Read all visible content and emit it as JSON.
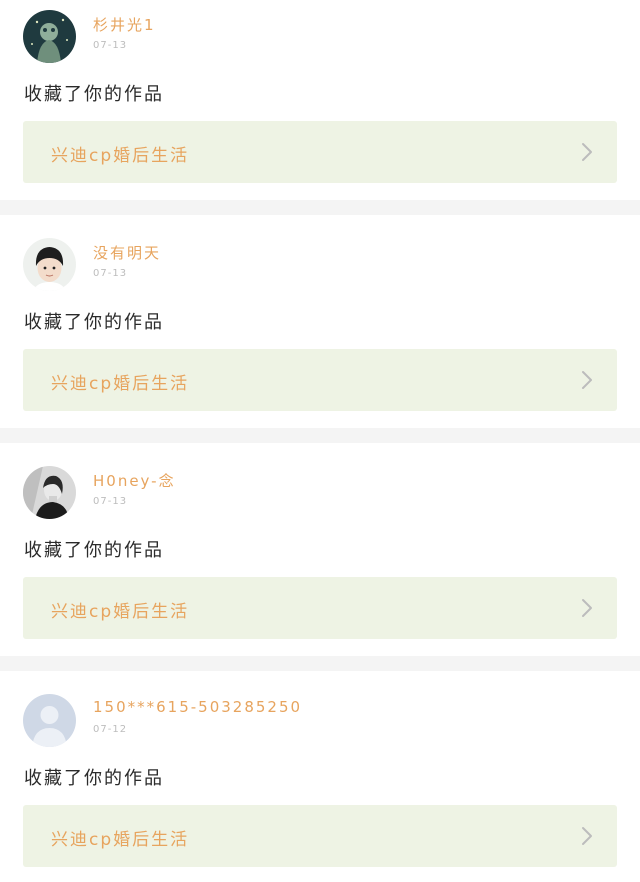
{
  "notifications": [
    {
      "username": "杉井光1",
      "date": "07-13",
      "action": "收藏了你的作品",
      "work_title": "兴迪cp婚后生活",
      "avatar_icon": "cartoon-character-avatar"
    },
    {
      "username": "没有明天",
      "date": "07-13",
      "action": "收藏了你的作品",
      "work_title": "兴迪cp婚后生活",
      "avatar_icon": "boy-photo-avatar"
    },
    {
      "username": "H0ney-念",
      "date": "07-13",
      "action": "收藏了你的作品",
      "work_title": "兴迪cp婚后生活",
      "avatar_icon": "monochrome-photo-avatar"
    },
    {
      "username": "150***615-503285250",
      "date": "07-12",
      "action": "收藏了你的作品",
      "work_title": "兴迪cp婚后生活",
      "avatar_icon": "default-user-avatar"
    }
  ],
  "colors": {
    "accent": "#e7a45e",
    "card_link_bg": "#eef3e4",
    "separator": "#f4f4f4",
    "date_text": "#bdbdbd"
  }
}
